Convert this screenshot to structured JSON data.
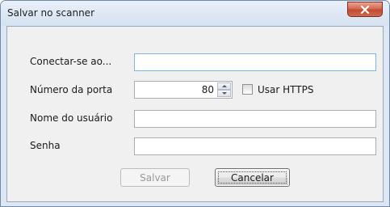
{
  "window": {
    "title": "Salvar no scanner",
    "close_icon": "close-x-icon"
  },
  "form": {
    "connect_label": "Conectar-se ao...",
    "connect_value": "",
    "port_label": "Número da porta",
    "port_value": "80",
    "https_label": "Usar HTTPS",
    "https_checked": false,
    "username_label": "Nome do usuário",
    "username_value": "",
    "password_label": "Senha",
    "password_value": ""
  },
  "buttons": {
    "save_label": "Salvar",
    "save_enabled": false,
    "cancel_label": "Cancelar"
  },
  "colors": {
    "close_button": "#c8553b",
    "focus_border": "#7eb4ea"
  }
}
